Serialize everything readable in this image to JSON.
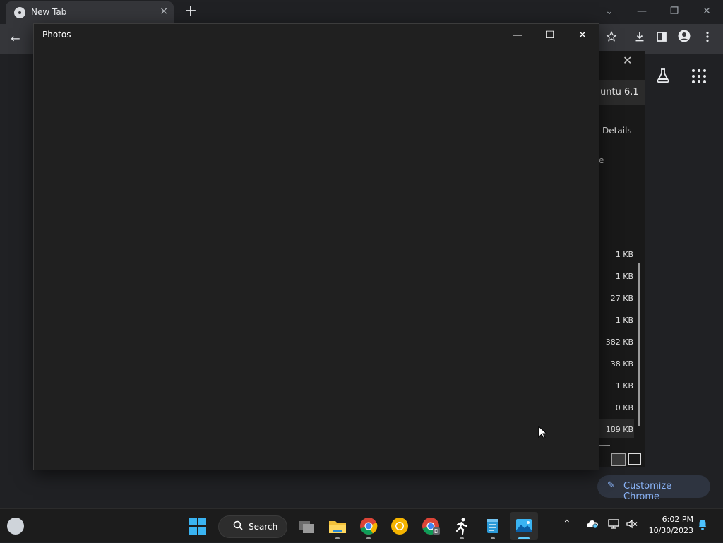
{
  "chrome": {
    "tab_title": "New Tab",
    "tab_close": "×",
    "new_tab": "+",
    "win_tabsearch": "⌄",
    "win_min": "—",
    "win_max": "❐",
    "win_close": "✕",
    "back": "←",
    "customize_label": "Customize Chrome",
    "customize_icon": "✎",
    "icons": [
      "back-arrow-icon",
      "star-icon",
      "download-icon",
      "side-panel-icon",
      "profile-icon",
      "menu-dots-icon",
      "labs-icon",
      "apps-grid-icon"
    ]
  },
  "dialog": {
    "close": "✕",
    "path_text": "untu 6.1",
    "details_label": "Details",
    "partial_text": "e",
    "sizes": [
      "1 KB",
      "1 KB",
      "27 KB",
      "1 KB",
      "382 KB",
      "38 KB",
      "1 KB",
      "0 KB",
      "189 KB"
    ]
  },
  "photos": {
    "title": "Photos",
    "min": "—",
    "max": "☐",
    "close": "✕"
  },
  "taskbar": {
    "search_label": "Search",
    "search_icon": "⌕",
    "tray_up": "⌃",
    "time": "6:02 PM",
    "date": "10/30/2023",
    "apps": [
      "task-view",
      "file-explorer",
      "chrome",
      "chrome-canary",
      "chrome-dev",
      "runner-app",
      "notepad",
      "photos"
    ]
  },
  "colors": {
    "accent": "#8ab4f8",
    "windows_blue": "#3ab4f2",
    "taskbar_active": "#60cdff"
  }
}
